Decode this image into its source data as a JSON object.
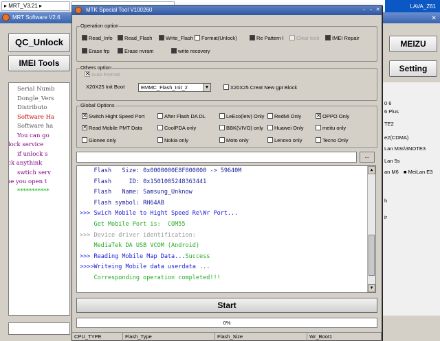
{
  "explorer": {
    "path_label": "MRT_V3.21",
    "taskbar_label": "LAVA_Z61"
  },
  "mrt": {
    "title": "MRT Software V2.6",
    "qc_unlock_label": "QC_Unlock",
    "imei_tools_label": "IMEI Tools",
    "meizu_label": "MEIZU",
    "setting_label": "Setting",
    "left_log_lines": [
      {
        "text": "Serial Numb",
        "color": "#555555"
      },
      {
        "text": "Dongle_Vers",
        "color": "#555555"
      },
      {
        "text": "Distributo",
        "color": "#555555"
      },
      {
        "text": "Software Ha",
        "color": "#cc0000"
      },
      {
        "text": "Software ha",
        "color": "#555555"
      },
      {
        "text": "You can go",
        "color": "#800080"
      },
      {
        "text": "unlock service",
        "color": "#800080"
      },
      {
        "text": "if unlock s",
        "color": "#800080"
      },
      {
        "text": "click anythink",
        "color": "#800080"
      },
      {
        "text": "swtich serv",
        "color": "#800080"
      },
      {
        "text": "time you open t",
        "color": "#800080"
      },
      {
        "text": "***********",
        "color": "#00aa00"
      }
    ],
    "right_list": [
      "0 6",
      "6 Plus",
      "TE2",
      "e2(CDMA)",
      "Lan M3s\\3NOTE3",
      "Lan 5s",
      "an M6",
      "MeiLan E3",
      "h",
      "ir"
    ]
  },
  "mtk": {
    "title": "MTK Special Tool V100260",
    "operation": {
      "title": "Operation option",
      "items": [
        {
          "label": "Read_Info",
          "state": "dark"
        },
        {
          "label": "Read_Flash",
          "state": "dark"
        },
        {
          "label": "Write_Flash",
          "state": "dark"
        },
        {
          "label": "Format(Unlock)",
          "state": "empty"
        },
        {
          "label": "Re Pattern l",
          "state": "dark"
        },
        {
          "label": "Clear lock",
          "state": "disabled"
        },
        {
          "label": "IMEI Repair",
          "state": "dark"
        },
        {
          "label": "Erase frp",
          "state": "dark"
        },
        {
          "label": "Erase nvram",
          "state": "dark"
        },
        {
          "label": "write recovery",
          "state": "dark"
        }
      ]
    },
    "others": {
      "title": "Others option",
      "auto_format": "Auto Format",
      "init_boot_label": "X20X25 Init Boot",
      "init_boot_value": "EMMC_Flash_Init_2",
      "creat_gpt": "X20X25 Creat New gpt Block"
    },
    "global": {
      "title": "Global Options",
      "items": [
        {
          "label": "Switch Hight Speed Port",
          "checked": true
        },
        {
          "label": "After Flash DA DL",
          "checked": false
        },
        {
          "label": "LeEco(letv) Only",
          "checked": false
        },
        {
          "label": "RedMi Only",
          "checked": false
        },
        {
          "label": "OPPO Only",
          "checked": true
        },
        {
          "label": "Read Mobile PMT Data",
          "checked": true
        },
        {
          "label": "CoolPDA only",
          "checked": false
        },
        {
          "label": "BBK(VIVO) only",
          "checked": false
        },
        {
          "label": "Huawei Only",
          "checked": false
        },
        {
          "label": "meitu only",
          "checked": false
        },
        {
          "label": "Gionee only",
          "checked": false
        },
        {
          "label": "Nokia only",
          "checked": false
        },
        {
          "label": "Moto only",
          "checked": false
        },
        {
          "label": "Lenovo only",
          "checked": false
        },
        {
          "label": "Tecno Only",
          "checked": false
        }
      ]
    },
    "browse_label": "...",
    "log": [
      {
        "text": "    Flash   Size: 0x0000000E8F800000 -> 59640M",
        "color": "#1a1a9c"
      },
      {
        "text": "    Flash     ID: 0x1501005248363441",
        "color": "#1a1a9c"
      },
      {
        "text": "    Flash   Name: Samsung_Unknow",
        "color": "#1a1a9c"
      },
      {
        "text": "    Flash symbol: RH64AB",
        "color": "#1a1a9c"
      },
      {
        "text": ">>> Swich Mobile to Hight Speed Re\\Wr Port...",
        "color": "#1a1ad8"
      },
      {
        "text": "    Get Mobile Port is:  COM55",
        "color": "#22aa22"
      },
      {
        "text": ">>> Device driver identification:",
        "color": "#999999"
      },
      {
        "text": "    MediaTek DA USB VCOM (Android)",
        "color": "#22aa22"
      },
      {
        "text": ">>> Reading Mobile Map Data...",
        "color": "#1a1ad8",
        "suffix": "Success",
        "suffix_color": "#22aa22"
      },
      {
        "text": ">>>>Writeing Mobile data userdata ...",
        "color": "#1a1ad8"
      },
      {
        "text": "    Corresponding operation completed!!!",
        "color": "#22aa22"
      }
    ],
    "start_label": "Start",
    "progress": {
      "text": "0%",
      "value": 0
    },
    "status": [
      "CPU_TYPE",
      "Flash_Type",
      "Flash_Size",
      "Wr_Boot1"
    ]
  }
}
